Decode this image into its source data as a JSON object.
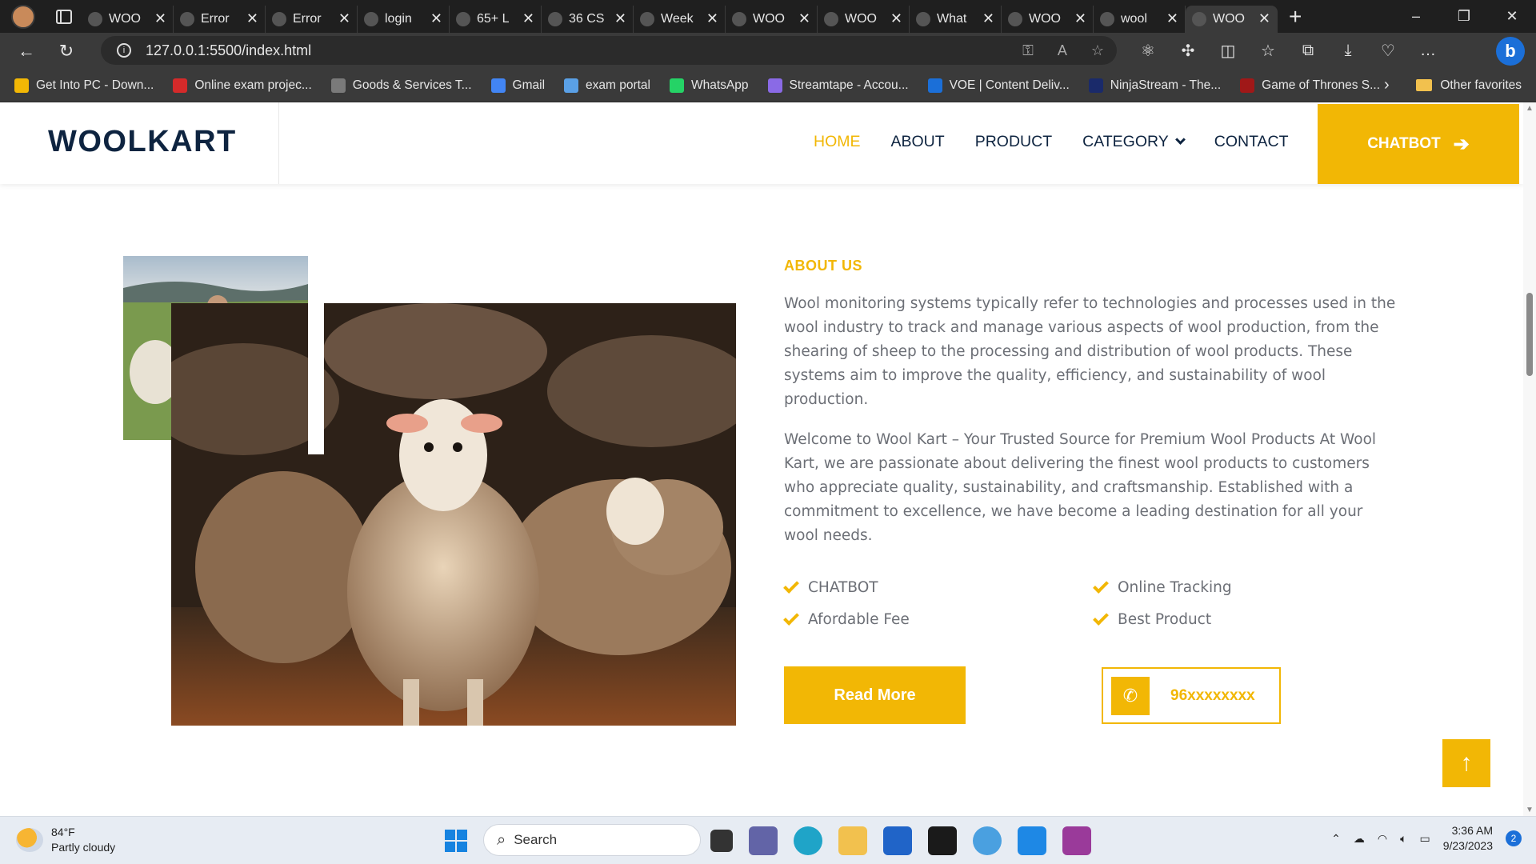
{
  "browser": {
    "tabs": [
      {
        "title": "WOO",
        "icon": "camera-icon"
      },
      {
        "title": "Error",
        "icon": "github-icon"
      },
      {
        "title": "Error",
        "icon": "github-icon"
      },
      {
        "title": "login",
        "icon": "search-icon"
      },
      {
        "title": "65+ L",
        "icon": "green-leaf-icon"
      },
      {
        "title": "36 CS",
        "icon": "f-icon"
      },
      {
        "title": "Week",
        "icon": "code-icon"
      },
      {
        "title": "WOO",
        "icon": "camera-icon"
      },
      {
        "title": "WOO",
        "icon": "camera-icon"
      },
      {
        "title": "What",
        "icon": "whatsapp-icon"
      },
      {
        "title": "WOO",
        "icon": "camera-icon"
      },
      {
        "title": "wool",
        "icon": "search-icon"
      },
      {
        "title": "WOO",
        "icon": "camera-icon"
      }
    ],
    "url": "127.0.0.1:5500/index.html",
    "bookmarks": [
      {
        "label": "Get Into PC - Down...",
        "color": "#f2b705"
      },
      {
        "label": "Online exam projec...",
        "color": "#d42a2a"
      },
      {
        "label": "Goods & Services T...",
        "color": "#7a7a7a"
      },
      {
        "label": "Gmail",
        "color": "#4285f4"
      },
      {
        "label": "exam portal",
        "color": "#5aa0e6"
      },
      {
        "label": "WhatsApp",
        "color": "#25d366"
      },
      {
        "label": "Streamtape - Accou...",
        "color": "#8a6ae6"
      },
      {
        "label": "VOE | Content Deliv...",
        "color": "#1b6fd8"
      },
      {
        "label": "NinjaStream - The...",
        "color": "#1a2a6a"
      },
      {
        "label": "Game of Thrones S...",
        "color": "#a01818"
      }
    ],
    "other_favorites": "Other favorites"
  },
  "site": {
    "logo": "WOOLKART",
    "menu": [
      "HOME",
      "ABOUT",
      "PRODUCT",
      "CATEGORY",
      "CONTACT"
    ],
    "chatbot_button": "CHATBOT",
    "accent_color": "#f2b705",
    "navy_color": "#0e2440"
  },
  "about": {
    "heading": "ABOUT US",
    "paragraph1": "Wool monitoring systems typically refer to technologies and processes used in the wool industry to track and manage various aspects of wool production, from the shearing of sheep to the processing and distribution of wool products. These systems aim to improve the quality, efficiency, and sustainability of wool production.",
    "paragraph2": "Welcome to Wool Kart – Your Trusted Source for Premium Wool Products At Wool Kart, we are passionate about delivering the finest wool products to customers who appreciate quality, sustainability, and craftsmanship. Established with a commitment to excellence, we have become a leading destination for all your wool needs.",
    "features": [
      "CHATBOT",
      "Online Tracking",
      "Afordable Fee",
      "Best Product"
    ],
    "read_more": "Read More",
    "phone": "96xxxxxxxx"
  },
  "taskbar": {
    "temperature": "84°F",
    "weather": "Partly cloudy",
    "search_placeholder": "Search",
    "time": "3:36 AM",
    "date": "9/23/2023",
    "notifications": "2"
  }
}
